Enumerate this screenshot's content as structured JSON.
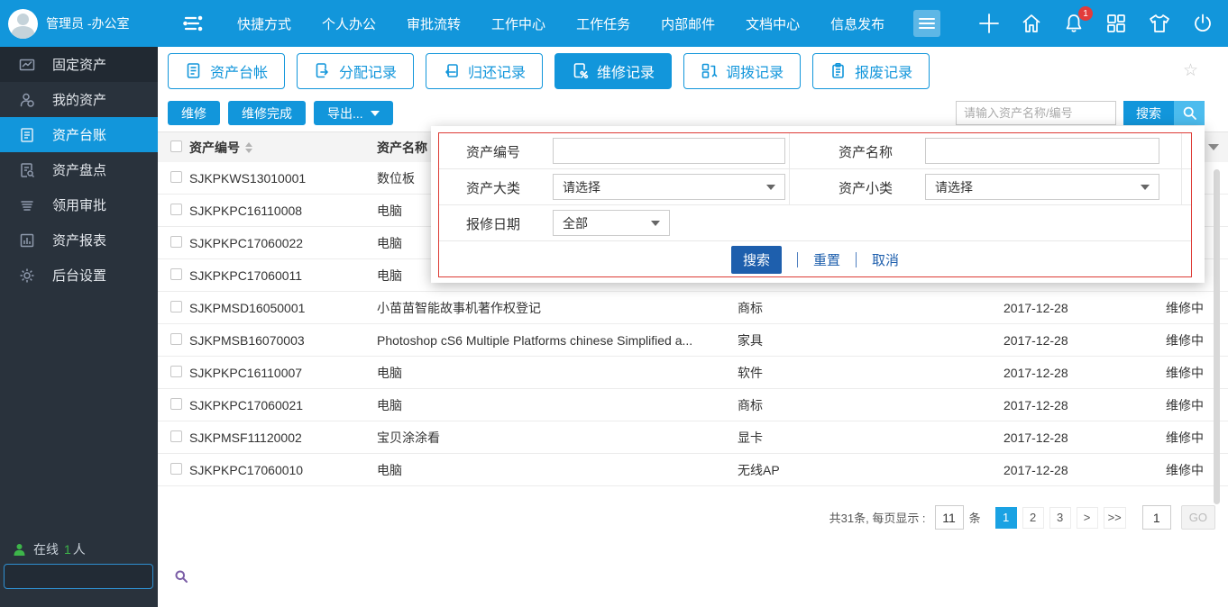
{
  "topbar": {
    "user_name": "管理员 -办公室",
    "nav_items": [
      "快捷方式",
      "个人办公",
      "审批流转",
      "工作中心",
      "工作任务",
      "内部邮件",
      "文档中心",
      "信息发布"
    ],
    "notification_badge": "1"
  },
  "sidebar": {
    "items": [
      {
        "label": "固定资产",
        "icon": "chart-icon"
      },
      {
        "label": "我的资产",
        "icon": "user-icon"
      },
      {
        "label": "资产台账",
        "icon": "ledger-icon",
        "active": true
      },
      {
        "label": "资产盘点",
        "icon": "doc-search-icon"
      },
      {
        "label": "领用审批",
        "icon": "approval-list-icon"
      },
      {
        "label": "资产报表",
        "icon": "report-icon"
      },
      {
        "label": "后台设置",
        "icon": "gear-icon"
      }
    ],
    "online_label": "在线",
    "online_count": "1",
    "online_unit": "人"
  },
  "tabs": [
    {
      "label": "资产台帐",
      "active": false
    },
    {
      "label": "分配记录",
      "active": false
    },
    {
      "label": "归还记录",
      "active": false
    },
    {
      "label": "维修记录",
      "active": true
    },
    {
      "label": "调拨记录",
      "active": false
    },
    {
      "label": "报废记录",
      "active": false
    }
  ],
  "toolbar": {
    "repair_label": "维修",
    "repair_done_label": "维修完成",
    "export_label": "导出...",
    "search_placeholder": "请输入资产名称/编号",
    "search_label": "搜索"
  },
  "table": {
    "headers": {
      "code": "资产编号",
      "name": "资产名称"
    },
    "rows": [
      {
        "code": "SJKPKWS13010001",
        "name": "数位板",
        "category": "",
        "date": "",
        "status": ""
      },
      {
        "code": "SJKPKPC16110008",
        "name": "电脑",
        "category": "",
        "date": "",
        "status": ""
      },
      {
        "code": "SJKPKPC17060022",
        "name": "电脑",
        "category": "",
        "date": "",
        "status": ""
      },
      {
        "code": "SJKPKPC17060011",
        "name": "电脑",
        "category": "",
        "date": "",
        "status": ""
      },
      {
        "code": "SJKPMSD16050001",
        "name": "小苗苗智能故事机著作权登记",
        "category": "商标",
        "date": "2017-12-28",
        "status": "维修中"
      },
      {
        "code": "SJKPMSB16070003",
        "name": "Photoshop cS6 Multiple Platforms chinese Simplified a...",
        "category": "家具",
        "date": "2017-12-28",
        "status": "维修中"
      },
      {
        "code": "SJKPKPC16110007",
        "name": "电脑",
        "category": "软件",
        "date": "2017-12-28",
        "status": "维修中"
      },
      {
        "code": "SJKPKPC17060021",
        "name": "电脑",
        "category": "商标",
        "date": "2017-12-28",
        "status": "维修中"
      },
      {
        "code": "SJKPMSF11120002",
        "name": "宝贝涂涂看",
        "category": "显卡",
        "date": "2017-12-28",
        "status": "维修中"
      },
      {
        "code": "SJKPKPC17060010",
        "name": "电脑",
        "category": "无线AP",
        "date": "2017-12-28",
        "status": "维修中"
      }
    ]
  },
  "popup": {
    "asset_code_label": "资产编号",
    "asset_name_label": "资产名称",
    "category_label": "资产大类",
    "category_value": "请选择",
    "subcategory_label": "资产小类",
    "subcategory_value": "请选择",
    "repair_date_label": "报修日期",
    "repair_date_value": "全部",
    "search_label": "搜索",
    "reset_label": "重置",
    "cancel_label": "取消"
  },
  "pagination": {
    "summary": "共31条, 每页显示 :",
    "page_size": "11",
    "unit": "条",
    "pages": [
      "1",
      "2",
      "3"
    ],
    "next_label": ">",
    "last_label": ">>",
    "goto_value": "1",
    "go_label": "GO"
  },
  "colors": {
    "accent_blue": "#1296db",
    "popup_border_red": "#dd3b35",
    "popup_button_blue": "#1e5fad",
    "badge_red": "#e23b3b",
    "online_green": "#3db54a",
    "pagination_active": "#1aa2e3"
  }
}
